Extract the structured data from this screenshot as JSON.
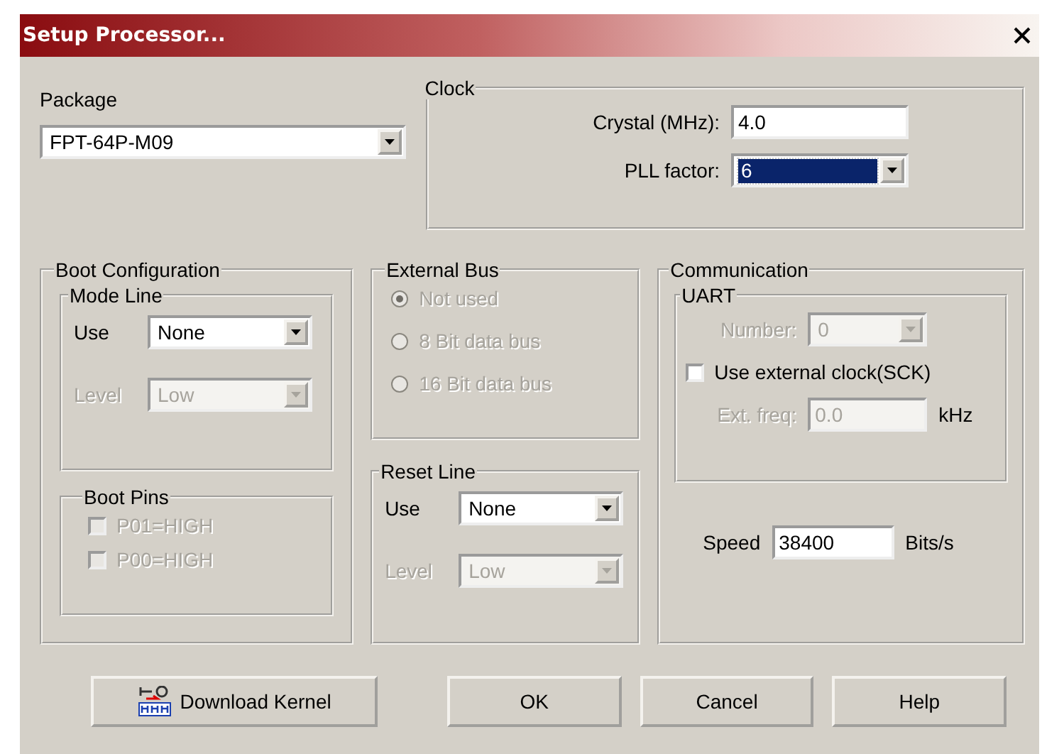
{
  "window": {
    "title": "Setup Processor..."
  },
  "package": {
    "label": "Package",
    "value": "FPT-64P-M09",
    "disabled": false
  },
  "clock": {
    "title": "Clock",
    "crystal": {
      "label": "Crystal (MHz):",
      "value": "4.0",
      "disabled": false
    },
    "pll_factor": {
      "label": "PLL factor:",
      "value": "6",
      "disabled": false,
      "focused": true
    }
  },
  "boot_configuration": {
    "title": "Boot Configuration",
    "mode_line": {
      "title": "Mode Line",
      "use": {
        "label": "Use",
        "value": "None",
        "disabled": false
      },
      "level": {
        "label": "Level",
        "value": "Low",
        "disabled": true
      }
    },
    "boot_pins": {
      "title": "Boot Pins",
      "pins": [
        {
          "label": "P01=HIGH",
          "checked": false,
          "disabled": true
        },
        {
          "label": "P00=HIGH",
          "checked": false,
          "disabled": true
        }
      ]
    }
  },
  "external_bus": {
    "title": "External Bus",
    "options": [
      {
        "label": "Not used",
        "selected": true,
        "disabled": true
      },
      {
        "label": "8 Bit data bus",
        "selected": false,
        "disabled": true
      },
      {
        "label": "16 Bit data bus",
        "selected": false,
        "disabled": true
      }
    ]
  },
  "reset_line": {
    "title": "Reset Line",
    "use": {
      "label": "Use",
      "value": "None",
      "disabled": false
    },
    "level": {
      "label": "Level",
      "value": "Low",
      "disabled": true
    }
  },
  "communication": {
    "title": "Communication",
    "uart": {
      "title": "UART",
      "number": {
        "label": "Number:",
        "value": "0",
        "disabled": true
      },
      "external_clock": {
        "label": "Use external clock(SCK)",
        "checked": false,
        "disabled": false
      },
      "ext_freq": {
        "label": "Ext. freq:",
        "value": "0.0",
        "unit": "kHz",
        "disabled": true
      }
    },
    "speed": {
      "label": "Speed",
      "value": "38400",
      "unit": "Bits/s",
      "disabled": false
    }
  },
  "buttons": [
    {
      "label": "Download Kernel",
      "kind": "icon"
    },
    {
      "label": "OK",
      "kind": "plain"
    },
    {
      "label": "Cancel",
      "kind": "plain"
    },
    {
      "label": "Help",
      "kind": "plain"
    }
  ]
}
